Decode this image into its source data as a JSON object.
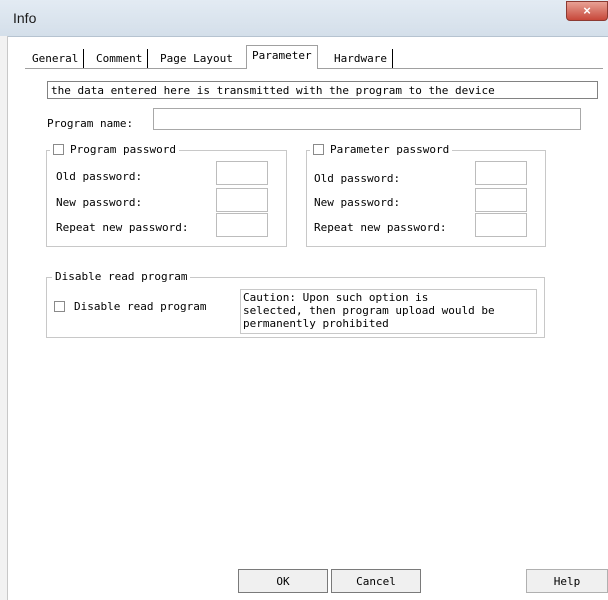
{
  "window": {
    "title": "Info",
    "close_glyph": "×"
  },
  "tabs": [
    {
      "label": "General"
    },
    {
      "label": "Comment"
    },
    {
      "label": "Page Layout"
    },
    {
      "label": "Parameter"
    },
    {
      "label": "Hardware"
    }
  ],
  "active_tab": "Parameter",
  "info_text": "the data entered here is transmitted with the program to the device",
  "program_name": {
    "label": "Program name:",
    "value": ""
  },
  "program_password": {
    "title": "Program password",
    "checked": false,
    "old_label": "Old password:",
    "new_label": "New password:",
    "repeat_label": "Repeat new password:"
  },
  "parameter_password": {
    "title": "Parameter password",
    "checked": false,
    "old_label": "Old password:",
    "new_label": "New password:",
    "repeat_label": "Repeat new password:"
  },
  "disable_read": {
    "title": "Disable read program",
    "checkbox_label": "Disable read program",
    "checked": false,
    "caution": "Caution: Upon such option is\nselected, then program upload would be\npermanently prohibited"
  },
  "buttons": {
    "ok": "OK",
    "cancel": "Cancel",
    "help": "Help"
  }
}
